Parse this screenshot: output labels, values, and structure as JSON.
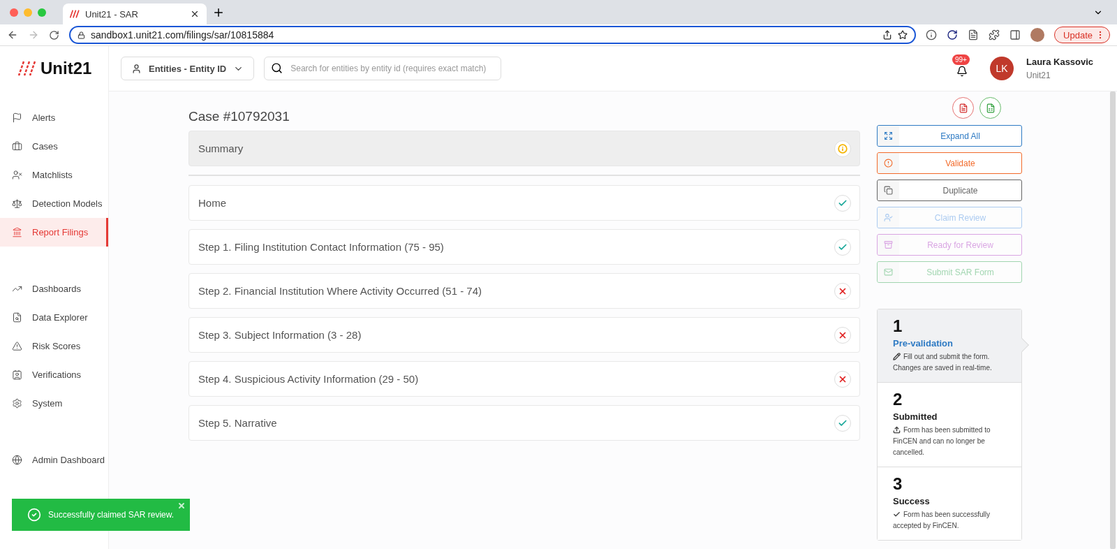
{
  "browser": {
    "tab_title": "Unit21 - SAR",
    "url": "sandbox1.unit21.com/filings/sar/10815884",
    "update_label": "Update"
  },
  "header": {
    "logo": "Unit21",
    "entity_selector": "Entities - Entity ID",
    "search": {
      "placeholder": "Search for entities by entity id (requires exact match)"
    },
    "notifications": "99+",
    "user": {
      "initials": "LK",
      "name": "Laura Kassovic",
      "org": "Unit21"
    }
  },
  "sidebar": {
    "groups": [
      [
        {
          "label": "Alerts",
          "selected": false
        },
        {
          "label": "Cases",
          "selected": false
        },
        {
          "label": "Matchlists",
          "selected": false
        },
        {
          "label": "Detection Models",
          "selected": false
        },
        {
          "label": "Report Filings",
          "selected": true
        }
      ],
      [
        {
          "label": "Dashboards",
          "selected": false
        },
        {
          "label": "Data Explorer",
          "selected": false
        },
        {
          "label": "Risk Scores",
          "selected": false
        },
        {
          "label": "Verifications",
          "selected": false
        },
        {
          "label": "System",
          "selected": false
        }
      ],
      [
        {
          "label": "Admin Dashboard",
          "selected": false
        }
      ]
    ]
  },
  "case_title": "Case #10792031",
  "summary": {
    "label": "Summary",
    "kind": "info"
  },
  "steps": [
    {
      "label": "Home",
      "kind": "ok"
    },
    {
      "label": "Step 1. Filing Institution Contact Information (75 - 95)",
      "kind": "ok"
    },
    {
      "label": "Step 2. Financial Institution Where Activity Occurred (51 - 74)",
      "kind": "error"
    },
    {
      "label": "Step 3. Subject Information (3 - 28)",
      "kind": "error"
    },
    {
      "label": "Step 4. Suspicious Activity Information (29 - 50)",
      "kind": "error"
    },
    {
      "label": "Step 5. Narrative",
      "kind": "ok"
    }
  ],
  "exports": [
    {
      "kind": "pdf"
    },
    {
      "kind": "excel"
    }
  ],
  "actions": [
    {
      "label": "Expand All",
      "kind": "expand",
      "disabled": false
    },
    {
      "label": "Validate",
      "kind": "validate",
      "disabled": false
    },
    {
      "label": "Duplicate",
      "kind": "duplicate",
      "disabled": false
    },
    {
      "label": "Claim Review",
      "kind": "claim",
      "disabled": true
    },
    {
      "label": "Ready for Review",
      "kind": "ready",
      "disabled": true
    },
    {
      "label": "Submit SAR Form",
      "kind": "submit",
      "disabled": true
    }
  ],
  "tracker": [
    {
      "number": "1",
      "title": "Pre-validation",
      "text": "Fill out and submit the form. Changes are saved in real-time.",
      "selected": true
    },
    {
      "number": "2",
      "title": "Submitted",
      "text": "Form has been submitted to FinCEN and can no longer be cancelled.",
      "selected": false
    },
    {
      "number": "3",
      "title": "Success",
      "text": "Form has been successfully accepted by FinCEN.",
      "selected": false
    }
  ],
  "toast": {
    "text": "Successfully claimed SAR review."
  }
}
